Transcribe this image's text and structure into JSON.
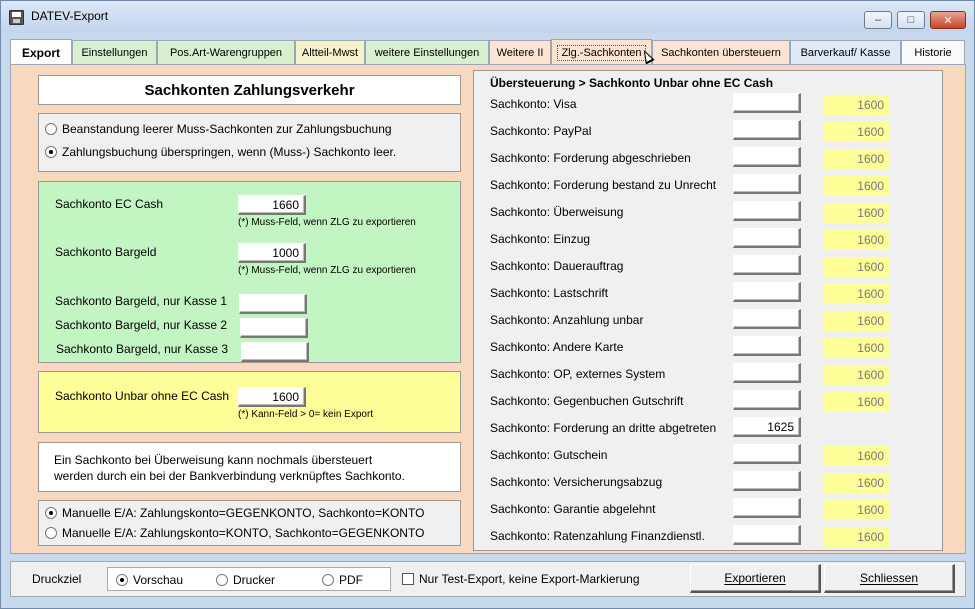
{
  "window": {
    "title": "DATEV-Export",
    "minimize": "–",
    "maximize": "□",
    "close": "✕"
  },
  "tabs": [
    {
      "label": "Export"
    },
    {
      "label": "Einstellungen"
    },
    {
      "label": "Pos.Art-Warengruppen"
    },
    {
      "label": "Altteil-Mwst"
    },
    {
      "label": "weitere Einstellungen"
    },
    {
      "label": "Weitere II"
    },
    {
      "label": "Zlg.-Sachkonten"
    },
    {
      "label": "Sachkonten übersteuern"
    },
    {
      "label": "Barverkauf/ Kasse"
    },
    {
      "label": "Historie"
    }
  ],
  "left": {
    "heading": "Sachkonten Zahlungsverkehr",
    "options": [
      {
        "label": "Beanstandung leerer Muss-Sachkonten zur Zahlungsbuchung",
        "selected": false
      },
      {
        "label": "Zahlungsbuchung überspringen, wenn (Muss-) Sachkonto leer.",
        "selected": true
      }
    ],
    "green": {
      "ec_cash_label": "Sachkonto EC Cash",
      "ec_cash_value": "1660",
      "ec_cash_note": "(*) Muss-Feld, wenn ZLG zu exportieren",
      "bargeld_label": "Sachkonto Bargeld",
      "bargeld_value": "1000",
      "bargeld_note": "(*) Muss-Feld, wenn ZLG zu exportieren",
      "kasse1_label": "Sachkonto Bargeld, nur Kasse 1",
      "kasse1_value": "",
      "kasse2_label": "Sachkonto Bargeld, nur Kasse 2",
      "kasse2_value": "",
      "kasse3_label": "Sachkonto Bargeld, nur Kasse 3",
      "kasse3_value": ""
    },
    "yellow": {
      "unbar_label": "Sachkonto Unbar ohne EC Cash",
      "unbar_value": "1600",
      "unbar_note": "(*) Kann-Feld > 0= kein Export"
    },
    "info": {
      "line1": "Ein Sachkonto bei Überweisung kann nochmals übersteuert",
      "line2": "werden durch ein bei der Bankverbindung verknüpftes Sachkonto."
    },
    "manual": [
      {
        "label": "Manuelle E/A: Zahlungskonto=GEGENKONTO, Sachkonto=KONTO",
        "selected": true
      },
      {
        "label": "Manuelle E/A: Zahlungskonto=KONTO, Sachkonto=GEGENKONTO",
        "selected": false
      }
    ]
  },
  "right": {
    "title": "Übersteuerung > Sachkonto Unbar ohne EC Cash",
    "rows": [
      {
        "label": "Sachkonto: Visa",
        "value": "",
        "default": "1600"
      },
      {
        "label": "Sachkonto: PayPal",
        "value": "",
        "default": "1600"
      },
      {
        "label": "Sachkonto: Forderung abgeschrieben",
        "value": "",
        "default": "1600"
      },
      {
        "label": "Sachkonto: Forderung bestand zu Unrecht",
        "value": "",
        "default": "1600"
      },
      {
        "label": "Sachkonto: Überweisung",
        "value": "",
        "default": "1600"
      },
      {
        "label": "Sachkonto: Einzug",
        "value": "",
        "default": "1600"
      },
      {
        "label": "Sachkonto: Dauerauftrag",
        "value": "",
        "default": "1600"
      },
      {
        "label": "Sachkonto: Lastschrift",
        "value": "",
        "default": "1600"
      },
      {
        "label": "Sachkonto: Anzahlung unbar",
        "value": "",
        "default": "1600"
      },
      {
        "label": "Sachkonto: Andere Karte",
        "value": "",
        "default": "1600"
      },
      {
        "label": "Sachkonto: OP, externes System",
        "value": "",
        "default": "1600"
      },
      {
        "label": "Sachkonto: Gegenbuchen Gutschrift",
        "value": "",
        "default": "1600"
      },
      {
        "label": "Sachkonto: Forderung an dritte abgetreten",
        "value": "1625",
        "default": ""
      },
      {
        "label": "Sachkonto: Gutschein",
        "value": "",
        "default": "1600"
      },
      {
        "label": "Sachkonto: Versicherungsabzug",
        "value": "",
        "default": "1600"
      },
      {
        "label": "Sachkonto: Garantie abgelehnt",
        "value": "",
        "default": "1600"
      },
      {
        "label": "Sachkonto: Ratenzahlung Finanzdienstl.",
        "value": "",
        "default": "1600"
      }
    ]
  },
  "bottom": {
    "druckziel_label": "Druckziel",
    "targets": [
      {
        "label": "Vorschau",
        "selected": true
      },
      {
        "label": "Drucker",
        "selected": false
      },
      {
        "label": "PDF",
        "selected": false
      }
    ],
    "test_export_label": "Nur Test-Export, keine Export-Markierung",
    "test_export_checked": false,
    "export_button": "Exportieren",
    "close_button": "Schliessen"
  }
}
